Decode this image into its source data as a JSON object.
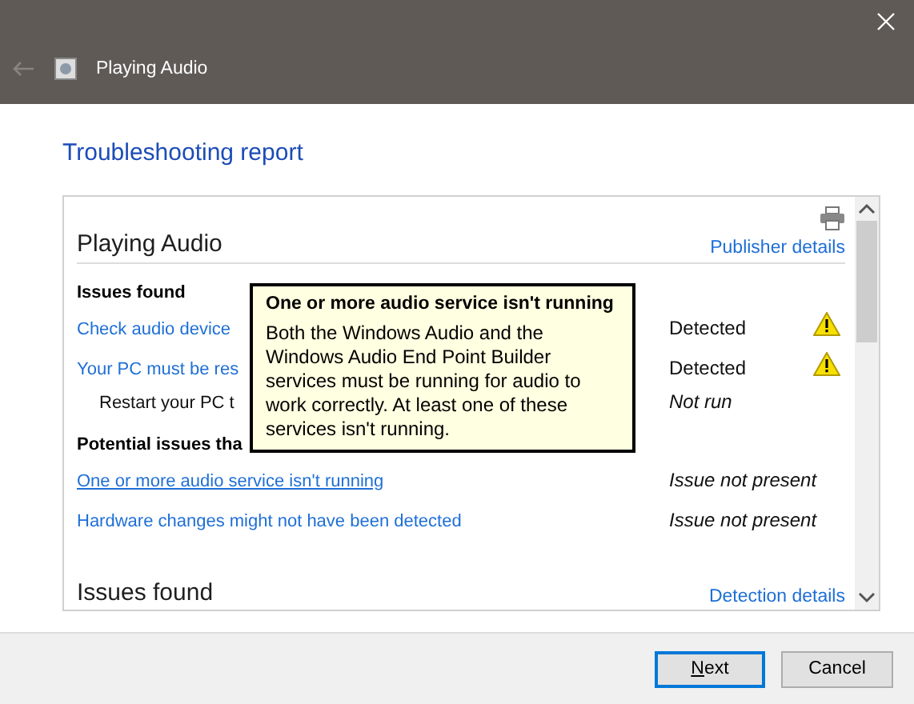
{
  "window": {
    "title": "Playing Audio"
  },
  "page_title": "Troubleshooting report",
  "report": {
    "title": "Playing Audio",
    "publisher_link": "Publisher details",
    "sections": [
      {
        "heading": "Issues found",
        "items": [
          {
            "kind": "link",
            "text": "Check audio device",
            "status": "Detected",
            "detected": true,
            "warning": true,
            "hovered": false
          },
          {
            "kind": "link",
            "text": "Your PC must be res",
            "status": "Detected",
            "detected": true,
            "warning": true,
            "hovered": false
          },
          {
            "kind": "note",
            "text": "Restart your PC t",
            "status": "Not run",
            "detected": false,
            "warning": false,
            "hovered": false
          }
        ]
      },
      {
        "heading": "Potential issues tha",
        "items": [
          {
            "kind": "link",
            "text": "One or more audio service isn't running",
            "status": "Issue not present",
            "detected": false,
            "warning": false,
            "hovered": true
          },
          {
            "kind": "link",
            "text": "Hardware changes might not have been detected",
            "status": "Issue not present",
            "detected": false,
            "warning": false,
            "hovered": false
          }
        ]
      }
    ],
    "footer_title": "Issues found",
    "footer_link": "Detection details"
  },
  "tooltip": {
    "title": "One or more audio service isn't running",
    "body": "Both the Windows Audio and the Windows Audio End Point Builder services must be running for audio to work correctly. At least one of these services isn't running."
  },
  "buttons": [
    {
      "label": "Next",
      "default": true
    },
    {
      "label": "Cancel",
      "default": false
    }
  ]
}
